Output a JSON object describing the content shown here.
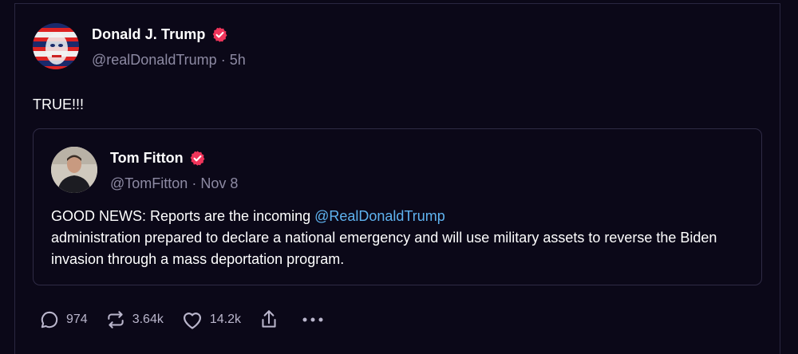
{
  "post": {
    "author_name": "Donald J. Trump",
    "handle": "@realDonaldTrump",
    "separator": "·",
    "time": "5h",
    "text": "TRUE!!!"
  },
  "quote": {
    "author_name": "Tom Fitton",
    "handle": "@TomFitton",
    "separator": "·",
    "date": "Nov 8",
    "text_before": "GOOD NEWS: Reports are the incoming ",
    "mention": "@RealDonaldTrump",
    "text_after": " administration prepared to declare a national emergency and will use military assets to reverse the Biden invasion through a mass deportation program."
  },
  "actions": {
    "replies": "974",
    "retruths": "3.64k",
    "likes": "14.2k"
  },
  "icons": {
    "verified": "verified-badge-icon",
    "reply": "speech-bubble-icon",
    "retruth": "repost-arrows-icon",
    "like": "heart-icon",
    "share": "share-icon",
    "more": "ellipsis-icon"
  },
  "colors": {
    "background": "#0b0818",
    "verified": "#f0355b",
    "mention": "#5fb3f0",
    "muted_text": "#8d8aa3"
  }
}
